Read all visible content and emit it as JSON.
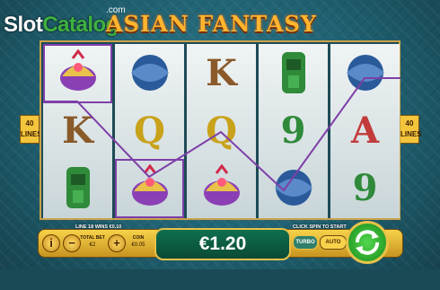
{
  "watermark": {
    "part1": "Slot",
    "part2": "Catalog",
    "suffix": ".com"
  },
  "game": {
    "title": "ASIAN FANTASY"
  },
  "lines_badge": {
    "value": "40",
    "label": "LINES"
  },
  "reels": [
    [
      "princess-lantern",
      "K",
      "jade-idol"
    ],
    [
      "koi-fish",
      "Q",
      "princess-lantern"
    ],
    [
      "K",
      "Q",
      "princess-lantern"
    ],
    [
      "jade-idol",
      "9",
      "koi-fish"
    ],
    [
      "koi-fish",
      "A",
      "9"
    ]
  ],
  "win_line_caption": "LINE 18 WINS €0.10",
  "bet": {
    "total_bet_label": "TOTAL BET",
    "total_bet_value": "€2",
    "coin_label": "COIN",
    "coin_value": "€0.05"
  },
  "win_amount": "€1.20",
  "spin_caption": "CLICK SPIN TO START",
  "buttons": {
    "info": "i",
    "minus": "−",
    "plus": "+",
    "turbo": "TURBO",
    "auto": "AUTO"
  },
  "colors": {
    "frame_gold": "#c9a24b",
    "winline": "#7d3fa8",
    "win_panel": "#0f6f4f",
    "spin_green": "#2fb52b"
  }
}
